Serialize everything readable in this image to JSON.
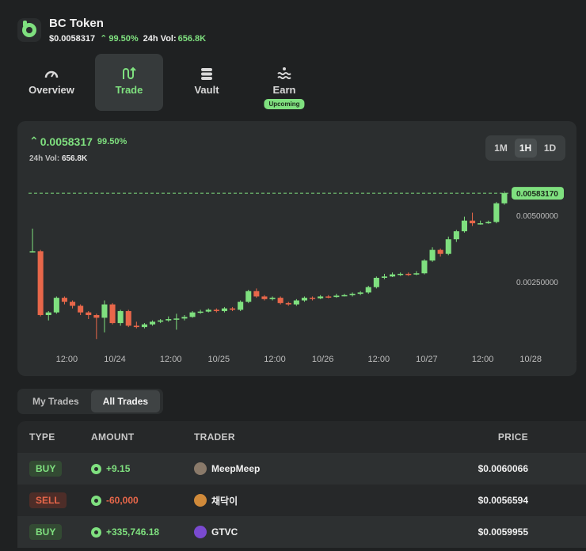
{
  "header": {
    "title": "BC Token",
    "price": "$0.0058317",
    "change": "99.50%",
    "vol_label": "24h Vol:",
    "vol_value": "656.8K",
    "logo_icon": "bc-coin-icon"
  },
  "tabs": [
    {
      "label": "Overview",
      "icon": "gauge-icon",
      "active": false
    },
    {
      "label": "Trade",
      "icon": "swap-arrows-icon",
      "active": true
    },
    {
      "label": "Vault",
      "icon": "stack-icon",
      "active": false
    },
    {
      "label": "Earn",
      "icon": "waves-icon",
      "active": false,
      "badge": "Upcoming"
    }
  ],
  "chart_panel": {
    "price": "0.0058317",
    "change": "99.50%",
    "vol_label": "24h Vol:",
    "vol_value": "656.8K",
    "ranges": [
      "1M",
      "1H",
      "1D"
    ],
    "active_range": "1H"
  },
  "chart_data": {
    "type": "candlestick",
    "title": "",
    "current_price_label": "0.00583170",
    "y_tick_labels": [
      "0.00500000",
      "0.00250000"
    ],
    "y_ticks": [
      0.005,
      0.0025
    ],
    "ylim": [
      0.0,
      0.0061
    ],
    "x_tick_labels": [
      "12:00",
      "10/24",
      "12:00",
      "10/25",
      "12:00",
      "10/26",
      "12:00",
      "10/27",
      "12:00",
      "10/28",
      "12:00"
    ],
    "x_tick_index": [
      4,
      10,
      17,
      23,
      30,
      36,
      43,
      49,
      56,
      62,
      69
    ],
    "candles": [
      [
        0.00365,
        0.00365,
        0.0045,
        0.0036
      ],
      [
        0.00365,
        0.00125,
        0.0037,
        0.0012
      ],
      [
        0.00125,
        0.00135,
        0.0014,
        0.00105
      ],
      [
        0.00135,
        0.0019,
        0.00195,
        0.0013
      ],
      [
        0.0019,
        0.00175,
        0.00195,
        0.00165
      ],
      [
        0.00175,
        0.0016,
        0.0018,
        0.0015
      ],
      [
        0.0016,
        0.00135,
        0.00165,
        0.00125
      ],
      [
        0.00135,
        0.00125,
        0.0014,
        0.0011
      ],
      [
        0.00125,
        0.00115,
        0.0013,
        0.00035
      ],
      [
        0.00115,
        0.00165,
        0.0018,
        0.0006
      ],
      [
        0.00165,
        0.00095,
        0.0017,
        0.0009
      ],
      [
        0.00095,
        0.0014,
        0.00145,
        0.00085
      ],
      [
        0.0014,
        0.00085,
        0.00145,
        0.0008
      ],
      [
        0.00085,
        0.0008,
        0.001,
        0.00075
      ],
      [
        0.0008,
        0.0009,
        0.00095,
        0.00075
      ],
      [
        0.0009,
        0.001,
        0.00105,
        0.00085
      ],
      [
        0.001,
        0.00105,
        0.0011,
        0.00095
      ],
      [
        0.00105,
        0.0011,
        0.0012,
        0.001
      ],
      [
        0.0011,
        0.00112,
        0.0013,
        0.0007
      ],
      [
        0.00112,
        0.00118,
        0.00125,
        0.00105
      ],
      [
        0.00118,
        0.00135,
        0.0014,
        0.00115
      ],
      [
        0.00135,
        0.00138,
        0.00145,
        0.0013
      ],
      [
        0.00138,
        0.00145,
        0.0015,
        0.00135
      ],
      [
        0.00145,
        0.0014,
        0.0015,
        0.00135
      ],
      [
        0.0014,
        0.0015,
        0.00155,
        0.00135
      ],
      [
        0.0015,
        0.00145,
        0.00155,
        0.0014
      ],
      [
        0.00145,
        0.00175,
        0.0018,
        0.0014
      ],
      [
        0.00175,
        0.00215,
        0.0022,
        0.0017
      ],
      [
        0.00215,
        0.00195,
        0.00225,
        0.0019
      ],
      [
        0.00195,
        0.00185,
        0.002,
        0.0018
      ],
      [
        0.00185,
        0.0019,
        0.00195,
        0.0018
      ],
      [
        0.0019,
        0.0017,
        0.00195,
        0.00165
      ],
      [
        0.0017,
        0.00165,
        0.00175,
        0.0016
      ],
      [
        0.00165,
        0.0018,
        0.00185,
        0.0016
      ],
      [
        0.0018,
        0.0019,
        0.00195,
        0.00175
      ],
      [
        0.0019,
        0.00188,
        0.00195,
        0.0018
      ],
      [
        0.00188,
        0.00195,
        0.002,
        0.00185
      ],
      [
        0.00195,
        0.00193,
        0.002,
        0.00188
      ],
      [
        0.00193,
        0.00198,
        0.00205,
        0.0019
      ],
      [
        0.00198,
        0.002,
        0.00205,
        0.00195
      ],
      [
        0.002,
        0.00205,
        0.0021,
        0.00195
      ],
      [
        0.00205,
        0.0021,
        0.00215,
        0.002
      ],
      [
        0.0021,
        0.0023,
        0.00235,
        0.00205
      ],
      [
        0.0023,
        0.00265,
        0.0027,
        0.00225
      ],
      [
        0.00265,
        0.0027,
        0.0028,
        0.0026
      ],
      [
        0.0027,
        0.00278,
        0.00285,
        0.00268
      ],
      [
        0.00278,
        0.0028,
        0.00285,
        0.00272
      ],
      [
        0.0028,
        0.00278,
        0.00285,
        0.00272
      ],
      [
        0.00278,
        0.00282,
        0.0029,
        0.00275
      ],
      [
        0.00282,
        0.0033,
        0.00335,
        0.00278
      ],
      [
        0.0033,
        0.0037,
        0.0038,
        0.00325
      ],
      [
        0.0037,
        0.00355,
        0.00375,
        0.00345
      ],
      [
        0.00355,
        0.0041,
        0.0042,
        0.0035
      ],
      [
        0.0041,
        0.0044,
        0.00445,
        0.004
      ],
      [
        0.0044,
        0.0048,
        0.00495,
        0.00435
      ],
      [
        0.0048,
        0.0047,
        0.0051,
        0.0046
      ],
      [
        0.0047,
        0.0047,
        0.0048,
        0.00465
      ],
      [
        0.0047,
        0.00475,
        0.0048,
        0.00468
      ],
      [
        0.00475,
        0.00545,
        0.0055,
        0.0047
      ],
      [
        0.00545,
        0.00583,
        0.0059,
        0.0054
      ]
    ],
    "colors": {
      "up": "#7fe07f",
      "down": "#e8674a",
      "grid": "#3a3e3f"
    }
  },
  "trade_tabs": [
    "My Trades",
    "All Trades"
  ],
  "active_trade_tab": "All Trades",
  "table": {
    "headers": {
      "type": "TYPE",
      "amount": "AMOUNT",
      "trader": "TRADER",
      "price": "PRICE"
    },
    "rows": [
      {
        "type": "BUY",
        "amount": "+9.15",
        "trader": "MeepMeep",
        "price": "$0.0060066",
        "avatar": "#8a7a6a"
      },
      {
        "type": "SELL",
        "amount": "-60,000",
        "trader": "채닥이",
        "price": "$0.0056594",
        "avatar": "#d08a3a"
      },
      {
        "type": "BUY",
        "amount": "+335,746.18",
        "trader": "GTVC",
        "price": "$0.0059955",
        "avatar": "#7a4ad0"
      }
    ]
  },
  "colors": {
    "accent": "#7fe07f",
    "sell": "#e8674a",
    "bg": "#1f2122",
    "card": "#2b2e2f"
  }
}
